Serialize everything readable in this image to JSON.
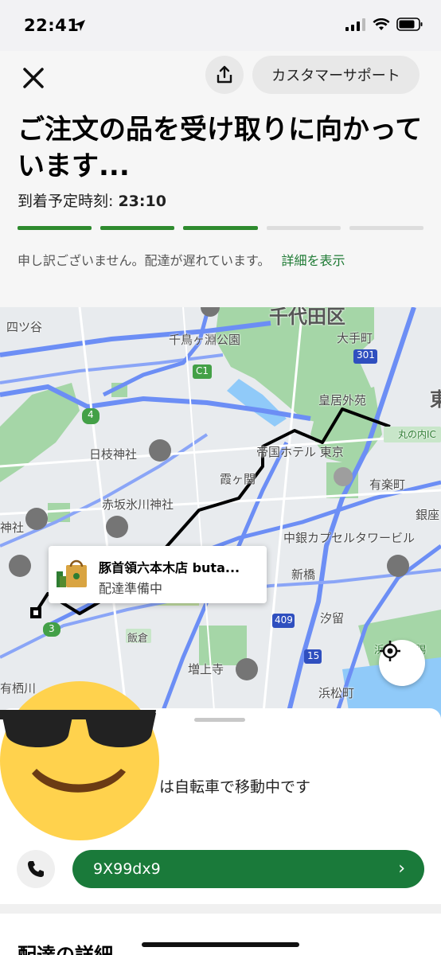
{
  "status_bar": {
    "time": "22:41"
  },
  "header": {
    "support_label": "カスタマーサポート",
    "title": "ご注文の品を受け取りに向かっています...",
    "eta_label": "到着予定時刻: ",
    "eta_time": "23:10",
    "progress": {
      "total_steps": 5,
      "completed_steps": 3,
      "active_color": "#2e8b2e",
      "inactive_color": "#dddddd"
    },
    "delay_message": "申し訳ございません。配達が遅れています。",
    "delay_link": "詳細を表示"
  },
  "map": {
    "labels": {
      "yotsuya": "四ツ谷",
      "chiyoda": "千代田区",
      "chidorigafuchi": "千鳥ヶ淵公園",
      "otemachi": "大手町",
      "route_301": "301",
      "c1": "C1",
      "kokyo_gaien": "皇居外苑",
      "higashi": "東",
      "route_4": "4",
      "marunouchi": "丸の内IC",
      "hie_jinja": "日枝神社",
      "imperial_hotel": "帝国ホテル 東京",
      "kasumigaseki": "霞ヶ関",
      "yurakucho": "有楽町",
      "akasaka_hikawa": "赤坂氷川神社",
      "ginza": "銀座",
      "jinja": "神社",
      "nakagin": "中銀カプセルタワービル",
      "shinbashi": "新橋",
      "shiodome": "汐留",
      "route_409": "409",
      "route_3": "3",
      "iikura": "飯倉",
      "zojoji": "増上寺",
      "route_15": "15",
      "hamamatsucho": "浜松町",
      "arisugawa": "有栖川",
      "hama_rikyu": "浜離宮恩賜"
    },
    "store": {
      "name": "豚首領六本木店 buta...",
      "status": "配達準備中"
    }
  },
  "sheet": {
    "courier_status": "は自転車で移動中です",
    "message_code": "9X99dx9",
    "message_chevron": "›",
    "details_title": "配達の詳細"
  }
}
